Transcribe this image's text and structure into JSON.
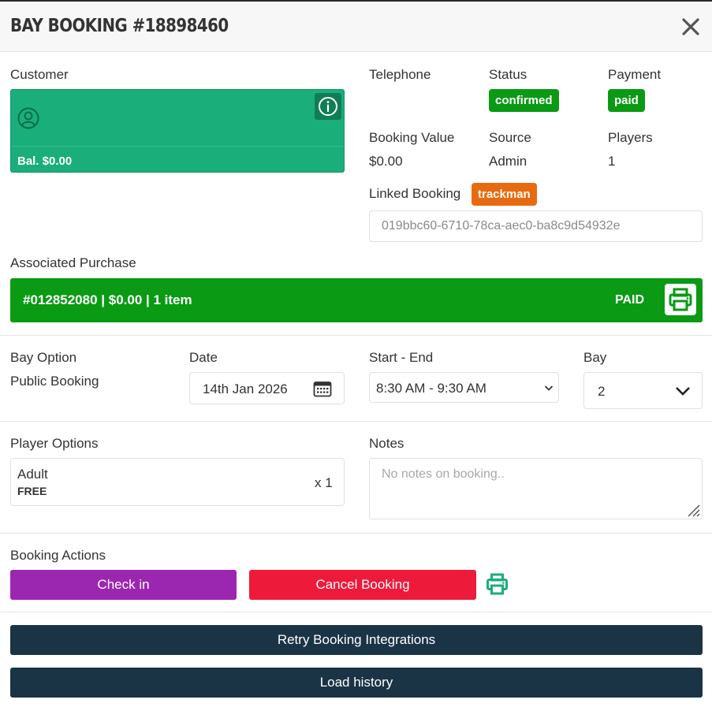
{
  "header": {
    "title": "BAY BOOKING #18898460"
  },
  "customer": {
    "label": "Customer",
    "balance": "Bal. $0.00"
  },
  "details": {
    "telephone_label": "Telephone",
    "status_label": "Status",
    "status_value": "confirmed",
    "payment_label": "Payment",
    "payment_value": "paid",
    "booking_value_label": "Booking Value",
    "booking_value": "$0.00",
    "source_label": "Source",
    "source_value": "Admin",
    "players_label": "Players",
    "players_value": "1",
    "linked_label": "Linked Booking",
    "linked_badge": "trackman",
    "linked_id": "019bbc60-6710-78ca-aec0-ba8c9d54932e"
  },
  "purchase": {
    "label": "Associated Purchase",
    "summary": "#012852080 | $0.00 | 1 item",
    "status": "PAID"
  },
  "booking": {
    "bay_option_label": "Bay Option",
    "bay_option_value": "Public Booking",
    "date_label": "Date",
    "date_value": "14th Jan 2026",
    "start_end_label": "Start - End",
    "start_end_value": "8:30 AM - 9:30 AM",
    "bay_label": "Bay",
    "bay_value": "2"
  },
  "players": {
    "label": "Player Options",
    "items": [
      {
        "name": "Adult",
        "price": "FREE",
        "qty": "x 1"
      }
    ]
  },
  "notes": {
    "label": "Notes",
    "placeholder": "No notes on booking.."
  },
  "actions": {
    "label": "Booking Actions",
    "check_in": "Check in",
    "cancel": "Cancel Booking",
    "retry": "Retry Booking Integrations",
    "history": "Load history"
  },
  "colors": {
    "customer_card": "#1aae7a",
    "paid_green": "#0a9a14",
    "trackman_orange": "#e86a10",
    "check_in_purple": "#9b27b0",
    "cancel_red": "#ee1a3a",
    "navy": "#1b3445"
  },
  "icons": {
    "close": "close-icon",
    "avatar": "user-circle-icon",
    "info": "info-icon",
    "print": "printer-icon",
    "calendar": "calendar-icon",
    "chevron": "chevron-down-icon",
    "resize": "resize-grip-icon"
  }
}
